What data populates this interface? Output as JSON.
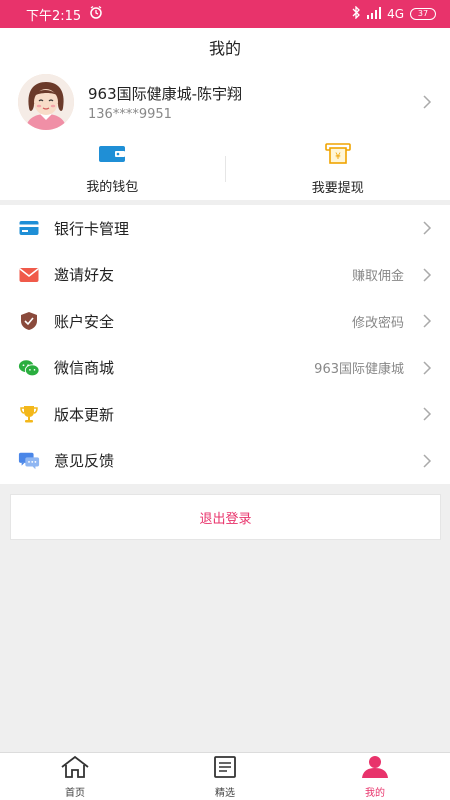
{
  "status_bar": {
    "time": "下午2:15",
    "network": "4G",
    "battery": "37"
  },
  "header": {
    "title": "我的"
  },
  "profile": {
    "name": "963国际健康城-陈宇翔",
    "phone": "136****9951"
  },
  "quick_actions": [
    {
      "label": "我的钱包",
      "icon": "wallet-icon"
    },
    {
      "label": "我要提现",
      "icon": "atm-icon"
    }
  ],
  "menu": [
    {
      "label": "银行卡管理",
      "right": "",
      "icon": "bank-card-icon"
    },
    {
      "label": "邀请好友",
      "right": "赚取佣金",
      "icon": "envelope-icon"
    },
    {
      "label": "账户安全",
      "right": "修改密码",
      "icon": "shield-icon"
    },
    {
      "label": "微信商城",
      "right": "963国际健康城",
      "icon": "wechat-icon"
    },
    {
      "label": "版本更新",
      "right": "",
      "icon": "trophy-icon"
    },
    {
      "label": "意见反馈",
      "right": "",
      "icon": "chat-bubble-icon"
    }
  ],
  "logout": {
    "label": "退出登录"
  },
  "tabs": [
    {
      "label": "首页",
      "icon": "home-icon",
      "active": false
    },
    {
      "label": "精选",
      "icon": "document-icon",
      "active": false
    },
    {
      "label": "我的",
      "icon": "user-icon",
      "active": true
    }
  ],
  "colors": {
    "accent": "#e8336b",
    "background": "#efefef"
  }
}
